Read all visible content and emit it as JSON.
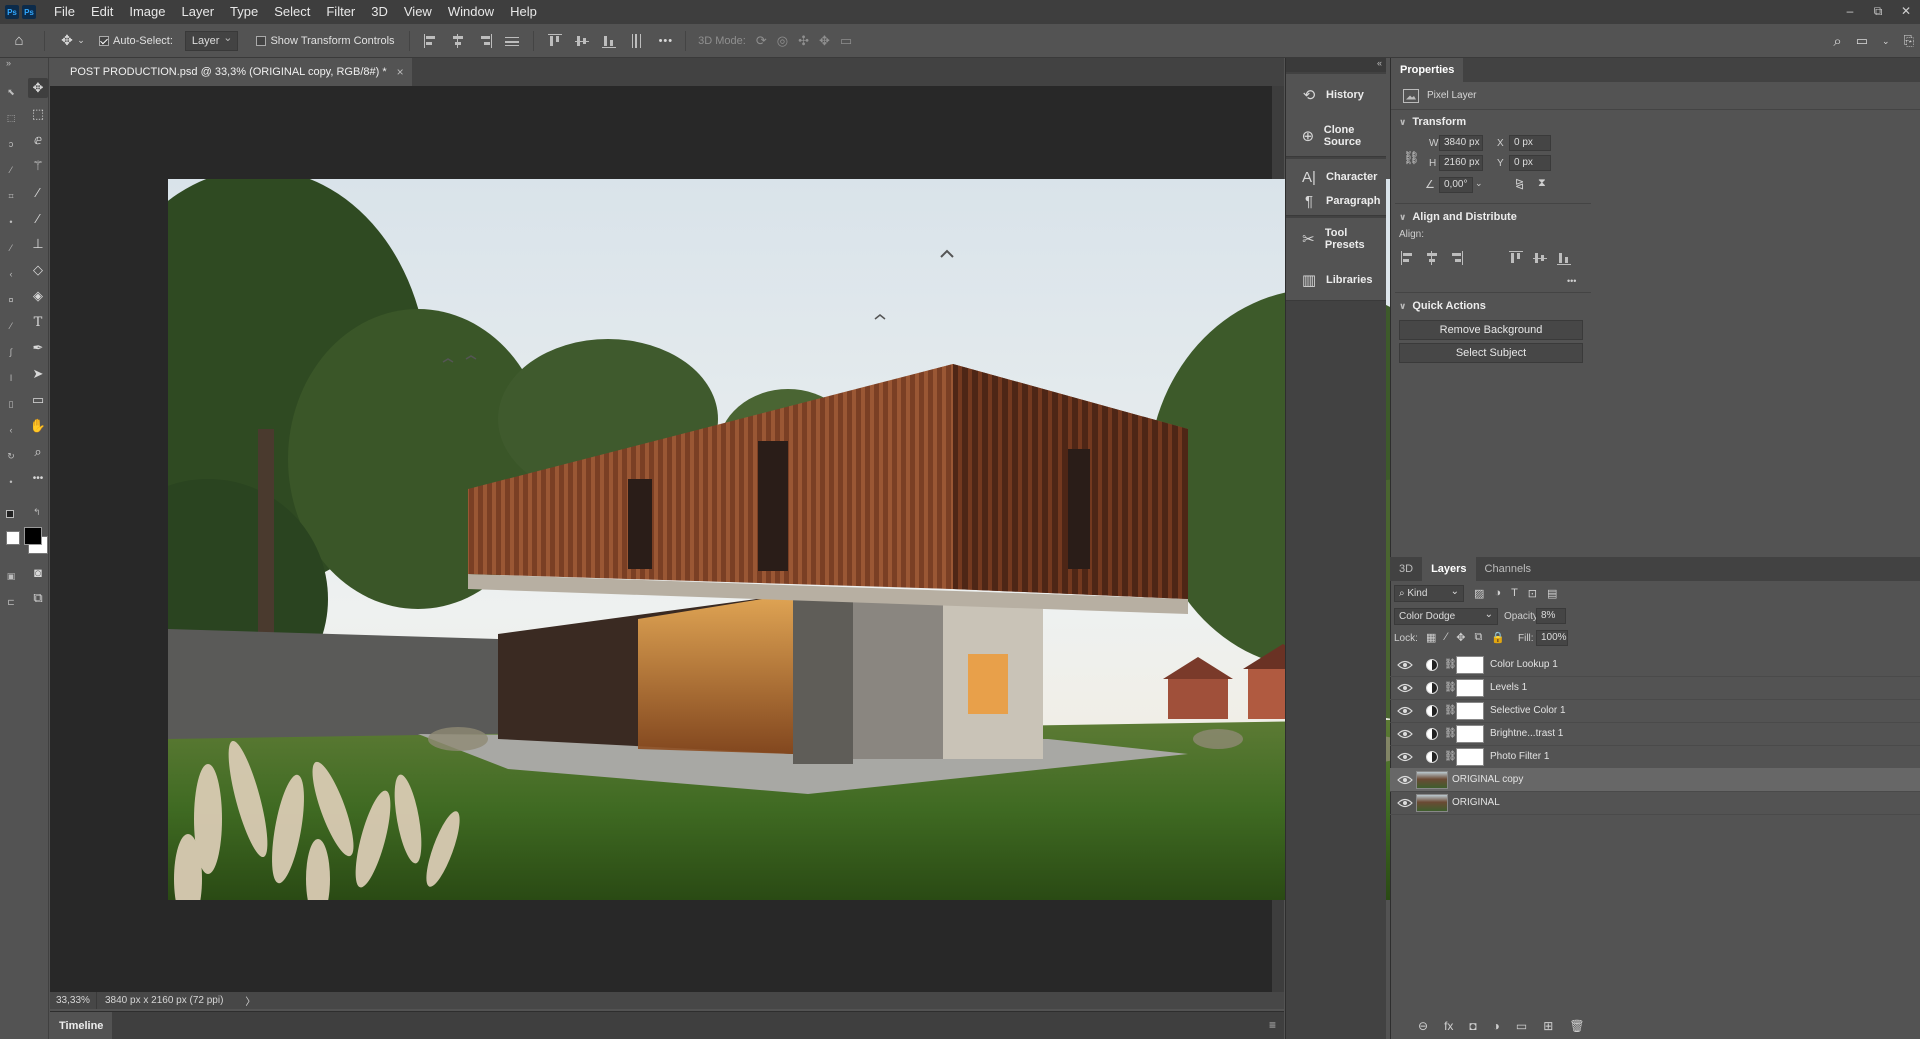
{
  "app": {
    "logo_text": "Ps"
  },
  "menu": {
    "items": [
      "File",
      "Edit",
      "Image",
      "Layer",
      "Type",
      "Select",
      "Filter",
      "3D",
      "View",
      "Window",
      "Help"
    ],
    "window_controls": [
      "–",
      "⧉",
      "✕"
    ]
  },
  "options_bar": {
    "auto_select_label": "Auto-Select:",
    "auto_select_target": "Layer",
    "show_transform_label": "Show Transform Controls",
    "mode_3d_label": "3D Mode:",
    "more_label": "•••"
  },
  "document": {
    "tab_title": "POST PRODUCTION.psd @ 33,3% (ORIGINAL copy, RGB/8#) *",
    "close_label": "×",
    "zoom": "33,33%",
    "doc_info": "3840 px x 2160 px (72 ppi)",
    "status_arrow": "〉"
  },
  "timeline": {
    "tab_label": "Timeline",
    "menu_icon": "≡"
  },
  "collapse_arrows": {
    "left": "»",
    "right": "«"
  },
  "dock_panels": [
    {
      "label": "History",
      "icon": "history-icon",
      "glyph": "⟲"
    },
    {
      "label": "Clone Source",
      "icon": "clone-source-icon",
      "glyph": "⊕"
    },
    {
      "label": "Character",
      "icon": "character-icon",
      "glyph": "A|"
    },
    {
      "label": "Paragraph",
      "icon": "paragraph-icon",
      "glyph": "¶"
    },
    {
      "label": "Tool Presets",
      "icon": "tool-presets-icon",
      "glyph": "✂"
    },
    {
      "label": "Libraries",
      "icon": "libraries-icon",
      "glyph": "▥"
    }
  ],
  "properties": {
    "tab_label": "Properties",
    "layer_kind": "Pixel Layer",
    "transform_title": "Transform",
    "w_label": "W",
    "w_value": "3840 px",
    "h_label": "H",
    "h_value": "2160 px",
    "x_label": "X",
    "x_value": "0 px",
    "y_label": "Y",
    "y_value": "0 px",
    "angle_value": "0,00°",
    "align_title": "Align and Distribute",
    "align_label": "Align:",
    "quick_actions_title": "Quick Actions",
    "remove_bg_label": "Remove Background",
    "select_subject_label": "Select Subject",
    "more_label": "•••"
  },
  "layers_panel": {
    "tabs": [
      "3D",
      "Layers",
      "Channels"
    ],
    "active_tab": "Layers",
    "filter_kind": "Kind",
    "blend_mode": "Color Dodge",
    "opacity_label": "Opacity:",
    "opacity_value": "8%",
    "lock_label": "Lock:",
    "fill_label": "Fill:",
    "fill_value": "100%",
    "layers": [
      {
        "name": "Color Lookup 1",
        "type": "adjustment",
        "selected": false
      },
      {
        "name": "Levels 1",
        "type": "adjustment",
        "selected": false
      },
      {
        "name": "Selective Color 1",
        "type": "adjustment",
        "selected": false
      },
      {
        "name": "Brightne...trast 1",
        "type": "adjustment",
        "selected": false
      },
      {
        "name": "Photo Filter 1",
        "type": "adjustment",
        "selected": false
      },
      {
        "name": "ORIGINAL copy",
        "type": "pixel",
        "selected": true
      },
      {
        "name": "ORIGINAL",
        "type": "pixel",
        "selected": false
      }
    ],
    "bottom_icons": [
      "link-layers-icon",
      "fx-icon",
      "add-mask-icon",
      "adjustment-layer-icon",
      "new-group-icon",
      "new-layer-icon",
      "delete-layer-icon"
    ],
    "bottom_glyphs": [
      "⊖",
      "fx",
      "◘",
      "◑",
      "▭",
      "⊞",
      "🗑"
    ]
  },
  "colors": {
    "bg_main": "#535353",
    "bg_dark": "#3e3e3e",
    "canvas": "#282828",
    "selected_layer": "#676767"
  }
}
